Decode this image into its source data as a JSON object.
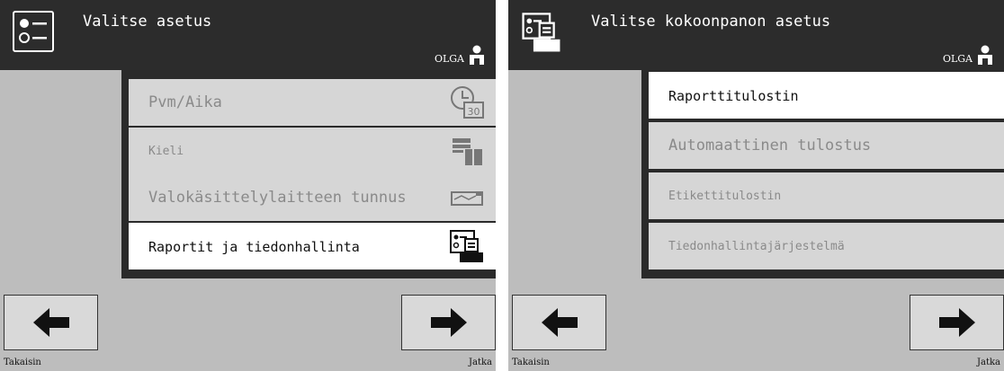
{
  "screens": [
    {
      "title": "Valitse asetus",
      "user": "OLGA",
      "items": [
        {
          "label": "Pvm/Aika",
          "icon": "calendar-clock-icon",
          "icon_text": "30"
        },
        {
          "label": "Kieli",
          "icon": "language-icon"
        },
        {
          "label": "Valokäsittelylaitteen tunnus",
          "icon": "processor-icon"
        },
        {
          "label": "Raportit ja tiedonhallinta",
          "icon": "reports-printer-icon"
        }
      ],
      "selected_index": 3,
      "back_label": "Takaisin",
      "next_label": "Jatka"
    },
    {
      "title": "Valitse kokoonpanon asetus",
      "user": "OLGA",
      "items": [
        {
          "label": "Raporttitulostin"
        },
        {
          "label": "Automaattinen tulostus"
        },
        {
          "label": "Etikettitulostin"
        },
        {
          "label": "Tiedonhallintajärjestelmä"
        }
      ],
      "selected_index": 0,
      "back_label": "Takaisin",
      "next_label": "Jatka"
    }
  ],
  "colors": {
    "header_bg": "#2c2c2c",
    "screen_bg": "#bdbdbd",
    "item_bg": "#d6d6d6",
    "item_selected_bg": "#ffffff",
    "item_text": "#8a8a8a",
    "item_selected_text": "#111111"
  }
}
